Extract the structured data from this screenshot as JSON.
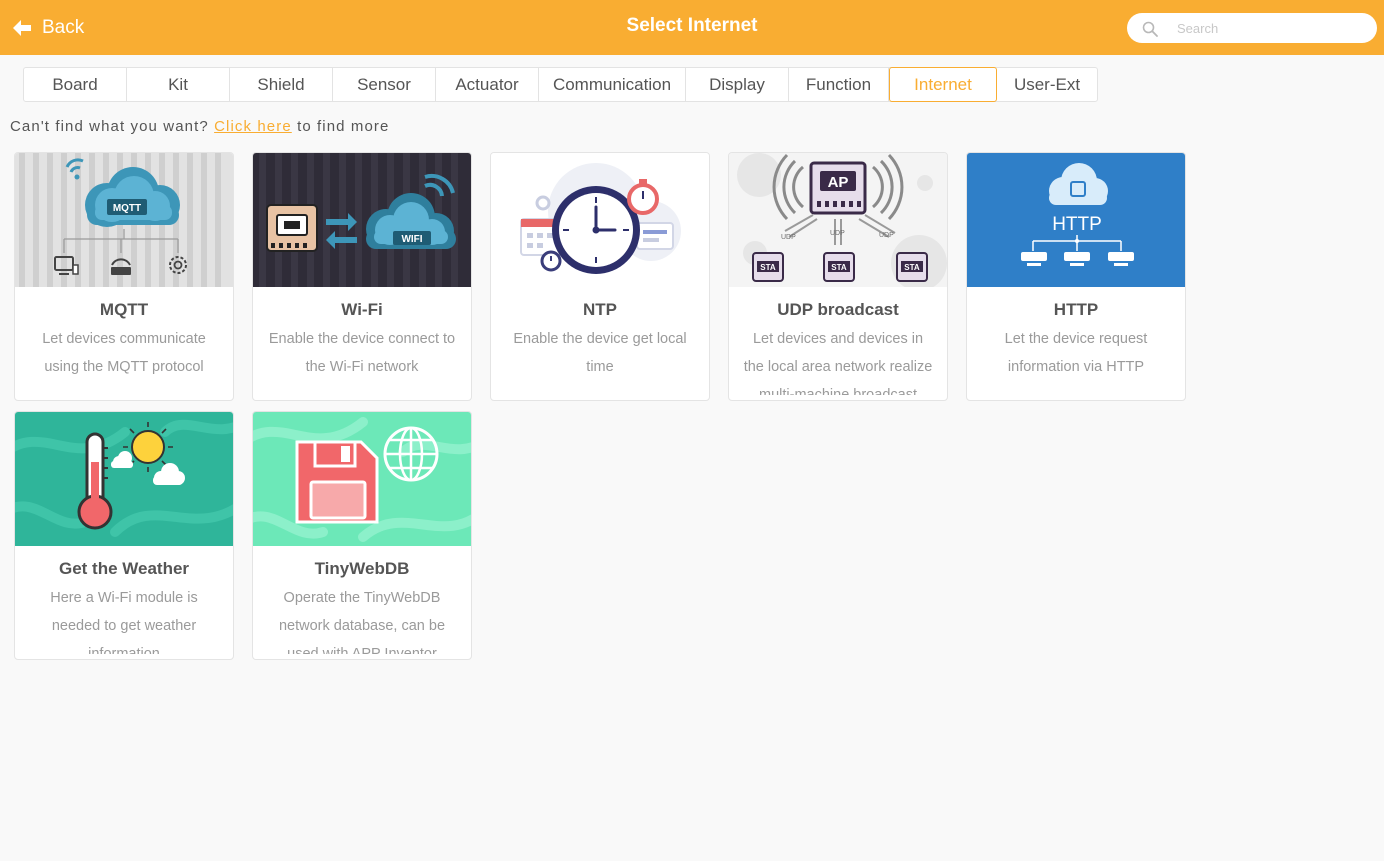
{
  "header": {
    "back_label": "Back",
    "title": "Select Internet",
    "search_placeholder": "Search"
  },
  "tabs": [
    {
      "label": "Board"
    },
    {
      "label": "Kit"
    },
    {
      "label": "Shield"
    },
    {
      "label": "Sensor"
    },
    {
      "label": "Actuator"
    },
    {
      "label": "Communication"
    },
    {
      "label": "Display"
    },
    {
      "label": "Function"
    },
    {
      "label": "Internet",
      "active": true
    },
    {
      "label": "User-Ext"
    }
  ],
  "hint": {
    "prefix": "Can't find what you want?",
    "link": "Click here",
    "suffix": "to find more"
  },
  "cards": [
    {
      "name": "MQTT",
      "desc": "Let devices communicate using the MQTT protocol",
      "icon": "mqtt-cloud-icon"
    },
    {
      "name": "Wi-Fi",
      "desc": "Enable the device connect to the Wi-Fi network",
      "icon": "wifi-cloud-icon"
    },
    {
      "name": "NTP",
      "desc": "Enable the device get local time",
      "icon": "clock-icon"
    },
    {
      "name": "UDP broadcast",
      "desc": "Let devices and devices in the local area network realize multi-machine broadcast",
      "icon": "ap-broadcast-icon"
    },
    {
      "name": "HTTP",
      "desc": "Let the device request information via HTTP",
      "icon": "http-cloud-icon"
    },
    {
      "name": "Get the Weather",
      "desc": "Here a Wi-Fi module is needed to get weather information",
      "icon": "weather-icon"
    },
    {
      "name": "TinyWebDB",
      "desc": "Operate the TinyWebDB network database, can be used with APP Inventor",
      "icon": "database-icon"
    }
  ],
  "image_labels": {
    "mqtt": "MQTT",
    "wifi": "WIFI",
    "ap": "AP",
    "udp": "UDP",
    "sta": "STA",
    "http": "HTTP"
  },
  "colors": {
    "accent": "#f9ad32",
    "link": "#f9ad32",
    "http_bg": "#2f7fc8",
    "weather_bg": "#2fb59a",
    "tinywebdb_bg": "#6ce8b8"
  }
}
